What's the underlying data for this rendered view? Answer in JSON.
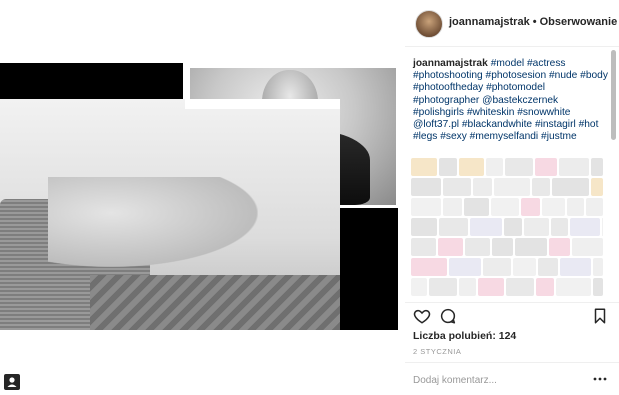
{
  "post": {
    "username": "joannamajstrak",
    "separator": "•",
    "follow_label": "Obserwowanie",
    "caption_user": "joannamajstrak",
    "caption_tags": [
      "#model",
      "#actress",
      "#photoshooting",
      "#photosesion",
      "#nude",
      "#body",
      "#photooftheday",
      "#photomodel",
      "#photographer",
      "@bastekczernek",
      "#polishgirls",
      "#whiteskin",
      "#snowwhite",
      "@loft37.pl",
      "#blackandwhite",
      "#instagirl",
      "#hot",
      "#legs",
      "#sexy",
      "#memyselfandi",
      "#justme"
    ],
    "likes_label": "Liczba polubień: 124",
    "date_label": "2 STYCZNIA",
    "comment_placeholder": "Dodaj komentarz...",
    "more_glyph": "•••"
  },
  "icons": {
    "like": "heart-icon",
    "comment": "comment-bubble-icon",
    "save": "bookmark-icon",
    "more": "more-options-icon",
    "tag": "person-tag-icon"
  },
  "colors": {
    "text": "#262626",
    "hashtag": "#003569",
    "muted": "#999999",
    "divider": "#efefef"
  }
}
